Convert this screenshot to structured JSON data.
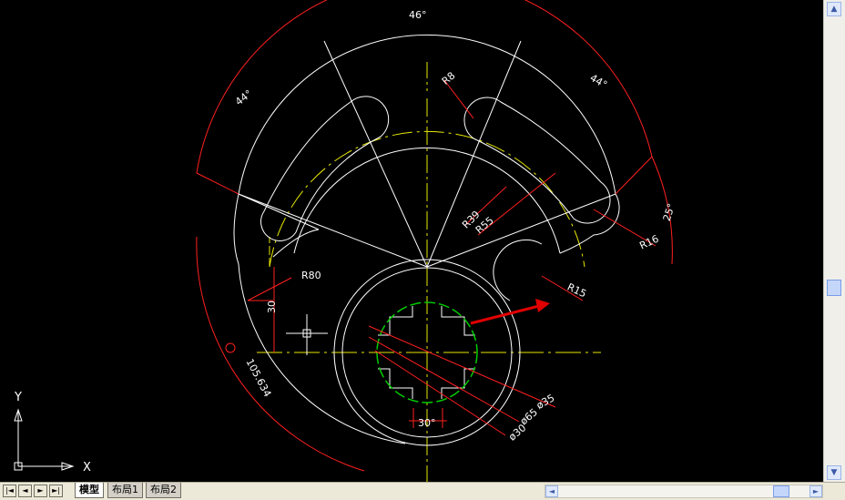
{
  "drawing": {
    "dims": {
      "angle_top": "46°",
      "angle_left": "44°",
      "angle_right": "44°",
      "angle_side": "25°",
      "angle_keyway": "30°",
      "r8": "R8",
      "r39": "R39",
      "r55": "R55",
      "r16": "R16",
      "r80": "R80",
      "r15": "R15",
      "d35": "ø35",
      "d65": "ø65",
      "d30": "ø30",
      "len30": "30",
      "arc_length": "105.634"
    },
    "ucs": {
      "y_label": "Y",
      "x_label": "X"
    }
  },
  "tabs": [
    {
      "label": "模型",
      "active": true
    },
    {
      "label": "布局1",
      "active": false
    },
    {
      "label": "布局2",
      "active": false
    }
  ],
  "colors": {
    "background": "#000000",
    "geometry": "#ffffff",
    "dimension": "#ff2020",
    "centerline": "#ffff00",
    "keyway_circle": "#00cc00"
  }
}
